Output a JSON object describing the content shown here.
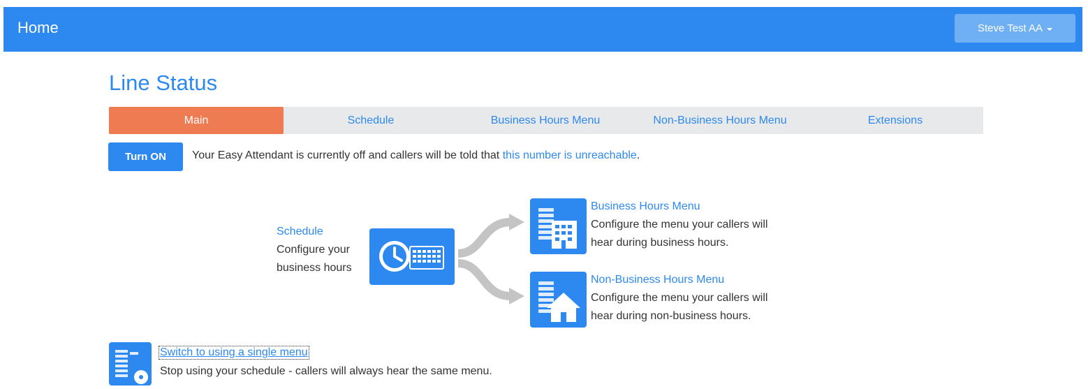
{
  "header": {
    "title": "Home",
    "user": "Steve Test AA"
  },
  "page": {
    "title": "Line Status"
  },
  "tabs": [
    {
      "label": "Main",
      "active": true
    },
    {
      "label": "Schedule",
      "active": false
    },
    {
      "label": "Business Hours Menu",
      "active": false
    },
    {
      "label": "Non-Business Hours Menu",
      "active": false
    },
    {
      "label": "Extensions",
      "active": false
    }
  ],
  "status": {
    "button": "Turn ON",
    "text_before": "Your Easy Attendant is currently off and callers will be told that ",
    "link": "this number is unreachable",
    "text_after": "."
  },
  "schedule": {
    "title": "Schedule",
    "line1": "Configure your",
    "line2": "business hours"
  },
  "business": {
    "title": "Business Hours Menu",
    "line1": "Configure the menu your callers will",
    "line2": "hear during business hours."
  },
  "nonbusiness": {
    "title": "Non-Business Hours Menu",
    "line1": "Configure the menu your callers will",
    "line2": "hear during non-business hours."
  },
  "single": {
    "link": "Switch to using a single menu",
    "desc": "Stop using your schedule - callers will always hear the same menu."
  },
  "colors": {
    "primary": "#2d89ef",
    "active_tab": "#ee7b52",
    "tabbar": "#e8e9eb",
    "arrow": "#c4c4c4"
  },
  "icons": [
    "clock-calendar-icon",
    "flow-arrows-icon",
    "office-building-icon",
    "house-icon",
    "menu-disc-icon",
    "caret-down-icon"
  ]
}
